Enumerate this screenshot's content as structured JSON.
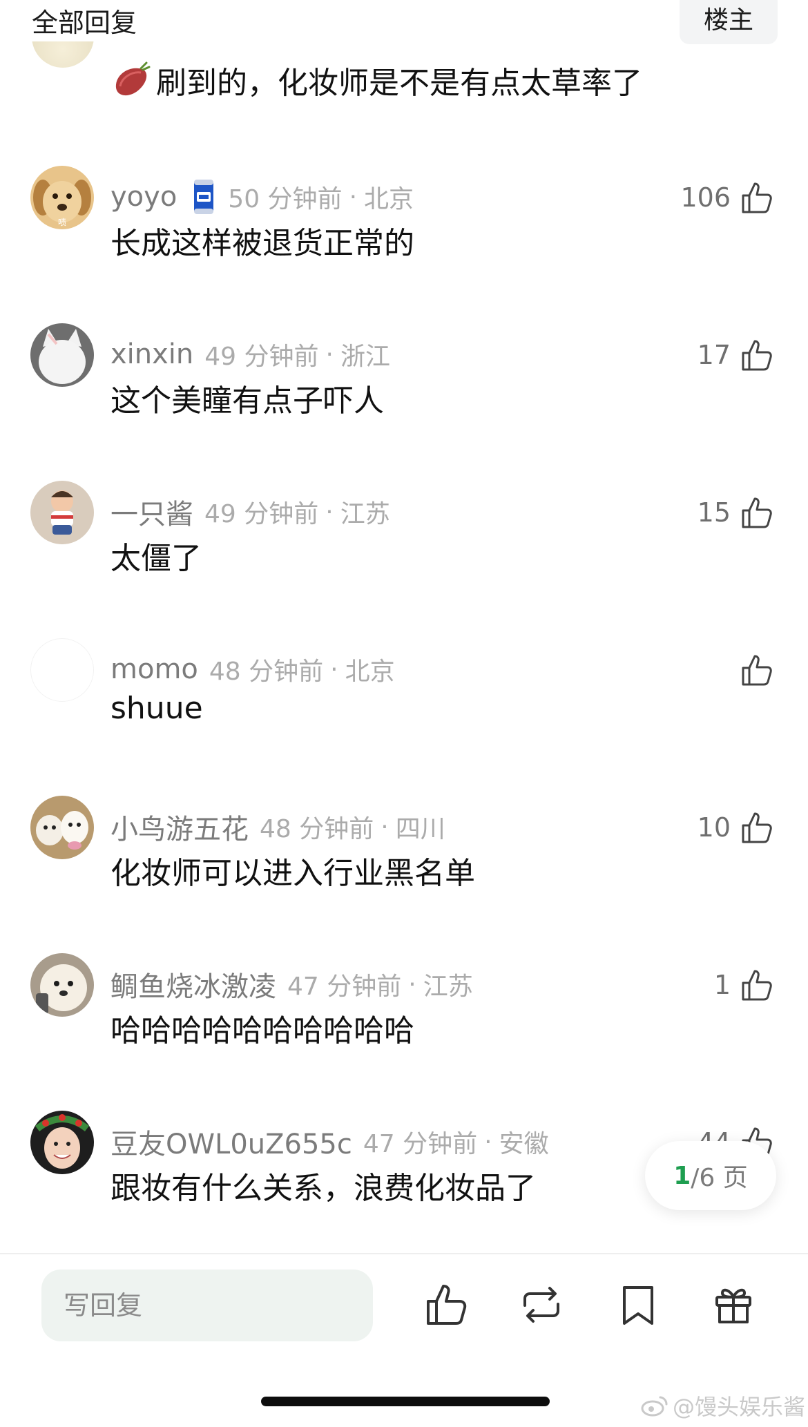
{
  "header": {
    "title": "全部回复",
    "owner_button": "楼主"
  },
  "partial_comment": {
    "text": "刷到的，化妆师是不是有点太草率了"
  },
  "comments": [
    {
      "username": "yoyo",
      "time": "50 分钟前",
      "location": "北京",
      "text": "长成这样被退货正常的",
      "likes": "106",
      "avatar_label": "啧"
    },
    {
      "username": "xinxin",
      "time": "49 分钟前",
      "location": "浙江",
      "text": "这个美瞳有点子吓人",
      "likes": "17"
    },
    {
      "username": "一只酱",
      "time": "49 分钟前",
      "location": "江苏",
      "text": "太僵了",
      "likes": "15"
    },
    {
      "username": "momo",
      "time": "48 分钟前",
      "location": "北京",
      "text": "shuue",
      "likes": ""
    },
    {
      "username": "小鸟游五花",
      "time": "48 分钟前",
      "location": "四川",
      "text": "化妆师可以进入行业黑名单",
      "likes": "10"
    },
    {
      "username": "鲷鱼烧冰激凌",
      "time": "47 分钟前",
      "location": "江苏",
      "text": "哈哈哈哈哈哈哈哈哈哈",
      "likes": "1"
    },
    {
      "username": "豆友OWL0uZ655c",
      "time": "47 分钟前",
      "location": "安徽",
      "text": "跟妆有什么关系，浪费化妆品了",
      "likes": "44"
    }
  ],
  "separator": "·",
  "pager": {
    "current": "1",
    "rest": "/6 页"
  },
  "bottom_bar": {
    "reply_placeholder": "写回复"
  },
  "watermark": "@馒头娱乐酱",
  "colors": {
    "accent_green": "#1e9e50",
    "input_bg": "#eef3f0",
    "meta_gray": "#ababab"
  }
}
